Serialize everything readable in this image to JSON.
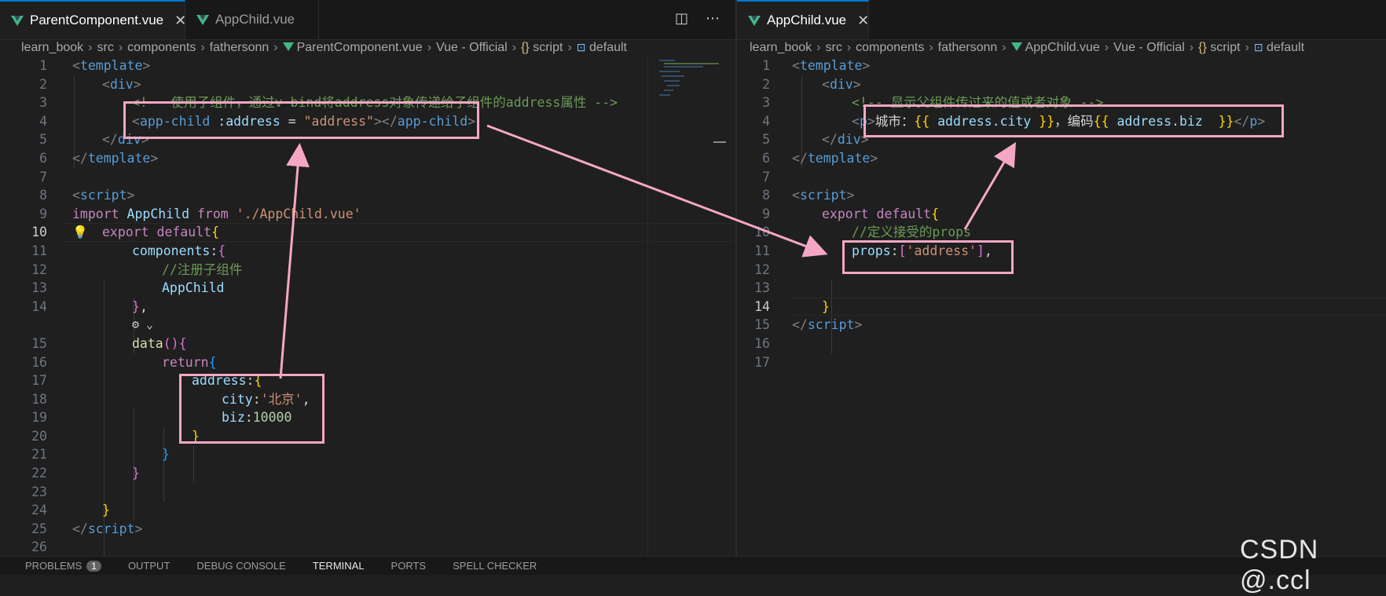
{
  "left": {
    "tabs": [
      {
        "label": "ParentComponent.vue",
        "active": true
      },
      {
        "label": "AppChild.vue",
        "active": false
      }
    ],
    "breadcrumb": [
      "learn_book",
      "src",
      "components",
      "fathersonn",
      "ParentComponent.vue",
      "Vue - Official",
      "script",
      "default"
    ],
    "lines": [
      "1",
      "2",
      "3",
      "4",
      "5",
      "6",
      "7",
      "8",
      "9",
      "10",
      "11",
      "12",
      "13",
      "14",
      "15",
      "16",
      "17",
      "18",
      "19",
      "20",
      "21",
      "22",
      "23",
      "24",
      "25",
      "26"
    ],
    "code": {
      "l1a": "<",
      "l1b": "template",
      "l1c": ">",
      "l2a": "<",
      "l2b": "div",
      "l2c": ">",
      "l3": "<!-- 使用子组件，通过v-bind将address对象传递给子组件的address属性 -->",
      "l4a": "<",
      "l4b": "app-child",
      "l4c": ":address",
      "l4d": " = ",
      "l4e": "\"address\"",
      "l4f": "></",
      "l4g": "app-child",
      "l4h": ">",
      "l5a": "</",
      "l5b": "div",
      "l5c": ">",
      "l6a": "</",
      "l6b": "template",
      "l6c": ">",
      "l8a": "<",
      "l8b": "script",
      "l8c": ">",
      "l9a": "import",
      "l9b": "AppChild",
      "l9c": "from",
      "l9d": "'./AppChild.vue'",
      "l10a": "export",
      "l10b": "default",
      "l10c": "{",
      "l11a": "components",
      "l11b": ":",
      "l11c": "{",
      "l12": "//注册子组件",
      "l13": "AppChild",
      "l14a": "}",
      "l14b": ",",
      "l15a": "data",
      "l15b": "()",
      "l15c": "{",
      "l16a": "return",
      "l16b": "{",
      "l17a": "address",
      "l17b": ":",
      "l17c": "{",
      "l18a": "city",
      "l18b": ":",
      "l18c": "'北京'",
      "l18d": ",",
      "l19a": "biz",
      "l19b": ":",
      "l19c": "10000",
      "l20": "}",
      "l21": "}",
      "l22": "}",
      "l24": "}",
      "l25a": "</",
      "l25b": "script",
      "l25c": ">"
    }
  },
  "right": {
    "tabs": [
      {
        "label": "AppChild.vue",
        "active": true
      }
    ],
    "breadcrumb": [
      "learn_book",
      "src",
      "components",
      "fathersonn",
      "AppChild.vue",
      "Vue - Official",
      "script",
      "default"
    ],
    "lines": [
      "1",
      "2",
      "3",
      "4",
      "5",
      "6",
      "7",
      "8",
      "9",
      "10",
      "11",
      "12",
      "13",
      "14",
      "15",
      "16",
      "17"
    ],
    "code": {
      "l1a": "<",
      "l1b": "template",
      "l1c": ">",
      "l2a": "<",
      "l2b": "div",
      "l2c": ">",
      "l3": "<!-- 显示父组件传过来的值或者对象 -->",
      "l4a": "<",
      "l4b": "p",
      "l4c": ">",
      "l4d": "城市：",
      "l4e": "{{ ",
      "l4f": "address.city",
      "l4g": " }}",
      "l4h": "，编码",
      "l4i": "{{ ",
      "l4j": "address.biz  ",
      "l4k": "}}",
      "l4l": "</",
      "l4m": "p",
      "l4n": ">",
      "l5a": "</",
      "l5b": "div",
      "l5c": ">",
      "l6a": "</",
      "l6b": "template",
      "l6c": ">",
      "l8a": "<",
      "l8b": "script",
      "l8c": ">",
      "l9a": "export",
      "l9b": "default",
      "l9c": "{",
      "l10": "//定义接受的props",
      "l11a": "props",
      "l11b": ":",
      "l11c": "[",
      "l11d": "'address'",
      "l11e": "]",
      "l11f": ",",
      "l14": "}",
      "l15a": "</",
      "l15b": "script",
      "l15c": ">"
    }
  },
  "panel_tabs": [
    {
      "label": "PROBLEMS",
      "badge": "1"
    },
    {
      "label": "OUTPUT"
    },
    {
      "label": "DEBUG CONSOLE"
    },
    {
      "label": "TERMINAL",
      "active": true
    },
    {
      "label": "PORTS"
    },
    {
      "label": "SPELL CHECKER"
    }
  ],
  "watermark": "CSDN @.ccl",
  "colors": {
    "annotation": "#f4a7c4",
    "vue_green": "#41b883",
    "accent": "#0078d4"
  },
  "icons": {
    "split": "split-editor-icon",
    "more": "more-actions-icon",
    "bulb": "lightbulb-icon",
    "close": "close-icon"
  }
}
